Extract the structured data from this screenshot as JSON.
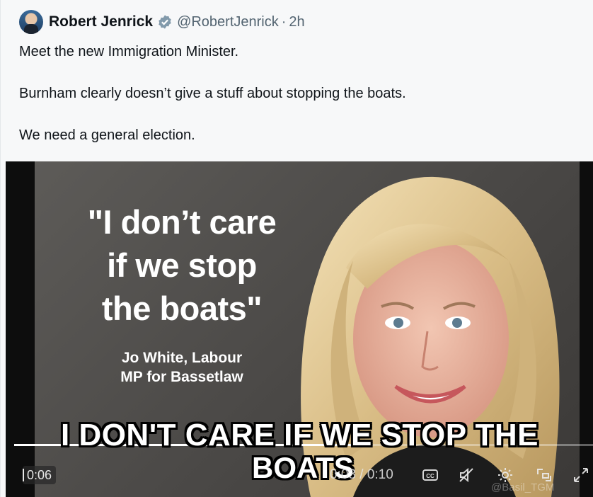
{
  "tweet": {
    "author_name": "Robert Jenrick",
    "handle": "@RobertJenrick",
    "separator": "·",
    "time": "2h",
    "paragraphs": [
      "Meet the new Immigration Minister.",
      "Burnham clearly doesn’t give a stuff about stopping the boats.",
      "We need a general election."
    ]
  },
  "video": {
    "quote_lines": [
      "\"I don’t care",
      "if we stop",
      "the boats\""
    ],
    "attribution_lines": [
      "Jo White, Labour",
      "MP for Bassetlaw"
    ],
    "caption_line1": "I DON'T CARE IF WE STOP THE",
    "caption_line2": "BOATS",
    "elapsed_badge": "0:06",
    "time_status": "0:03 / 0:10",
    "progress": 0.6,
    "watermark": "@Basil_TGM",
    "controls": [
      "captions-icon",
      "mute-icon",
      "settings-icon",
      "pip-icon",
      "fullscreen-icon"
    ]
  },
  "colors": {
    "verified_badge": "#829aab",
    "text": "#0f1419",
    "secondary_text": "#536471"
  }
}
